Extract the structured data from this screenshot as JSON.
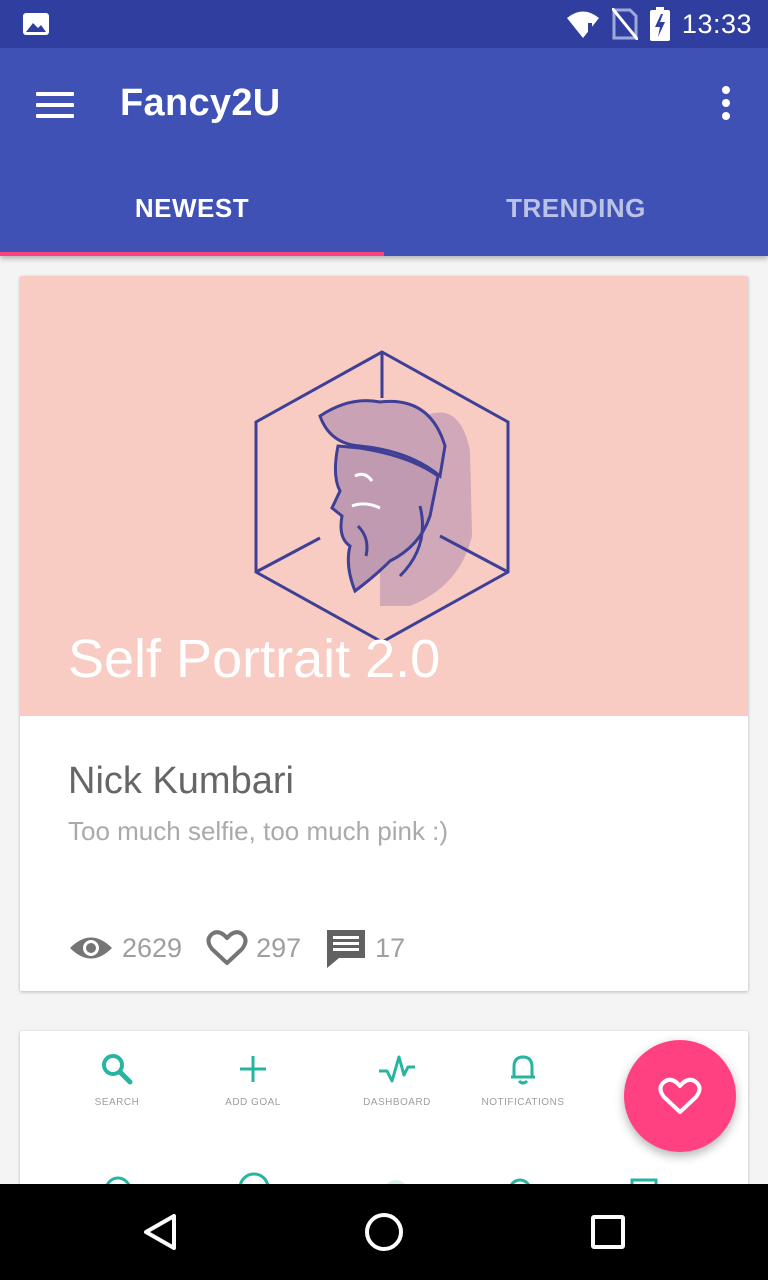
{
  "status_bar": {
    "time": "13:33",
    "icons": [
      "image-icon",
      "wifi-icon",
      "no-sim-icon",
      "battery-charging-icon"
    ]
  },
  "app_bar": {
    "title": "Fancy2U",
    "menu_icon": "menu-icon",
    "overflow_icon": "more-vert-icon",
    "tabs": [
      {
        "label": "NEWEST",
        "active": true
      },
      {
        "label": "TRENDING",
        "active": false
      }
    ],
    "indicator_color": "#ff4081",
    "color": "#3f51b5"
  },
  "cards": [
    {
      "media_title": "Self Portrait 2.0",
      "media_color": "#f8cbc3",
      "author": "Nick Kumbari",
      "description": "Too much selfie, too much pink :)",
      "stats": {
        "views": "2629",
        "likes": "297",
        "comments": "17"
      }
    },
    {
      "icon_grid": [
        {
          "label": "SEARCH",
          "icon": "search-icon"
        },
        {
          "label": "ADD GOAL",
          "icon": "plus-icon"
        },
        {
          "label": "DASHBOARD",
          "icon": "pulse-icon"
        },
        {
          "label": "NOTIFICATIONS",
          "icon": "bell-icon"
        }
      ],
      "accent": "#26b5a0"
    }
  ],
  "fab": {
    "icon": "heart-icon",
    "color": "#ff4081"
  },
  "nav_bar": {
    "icons": [
      "back-icon",
      "home-icon",
      "recents-icon"
    ]
  }
}
